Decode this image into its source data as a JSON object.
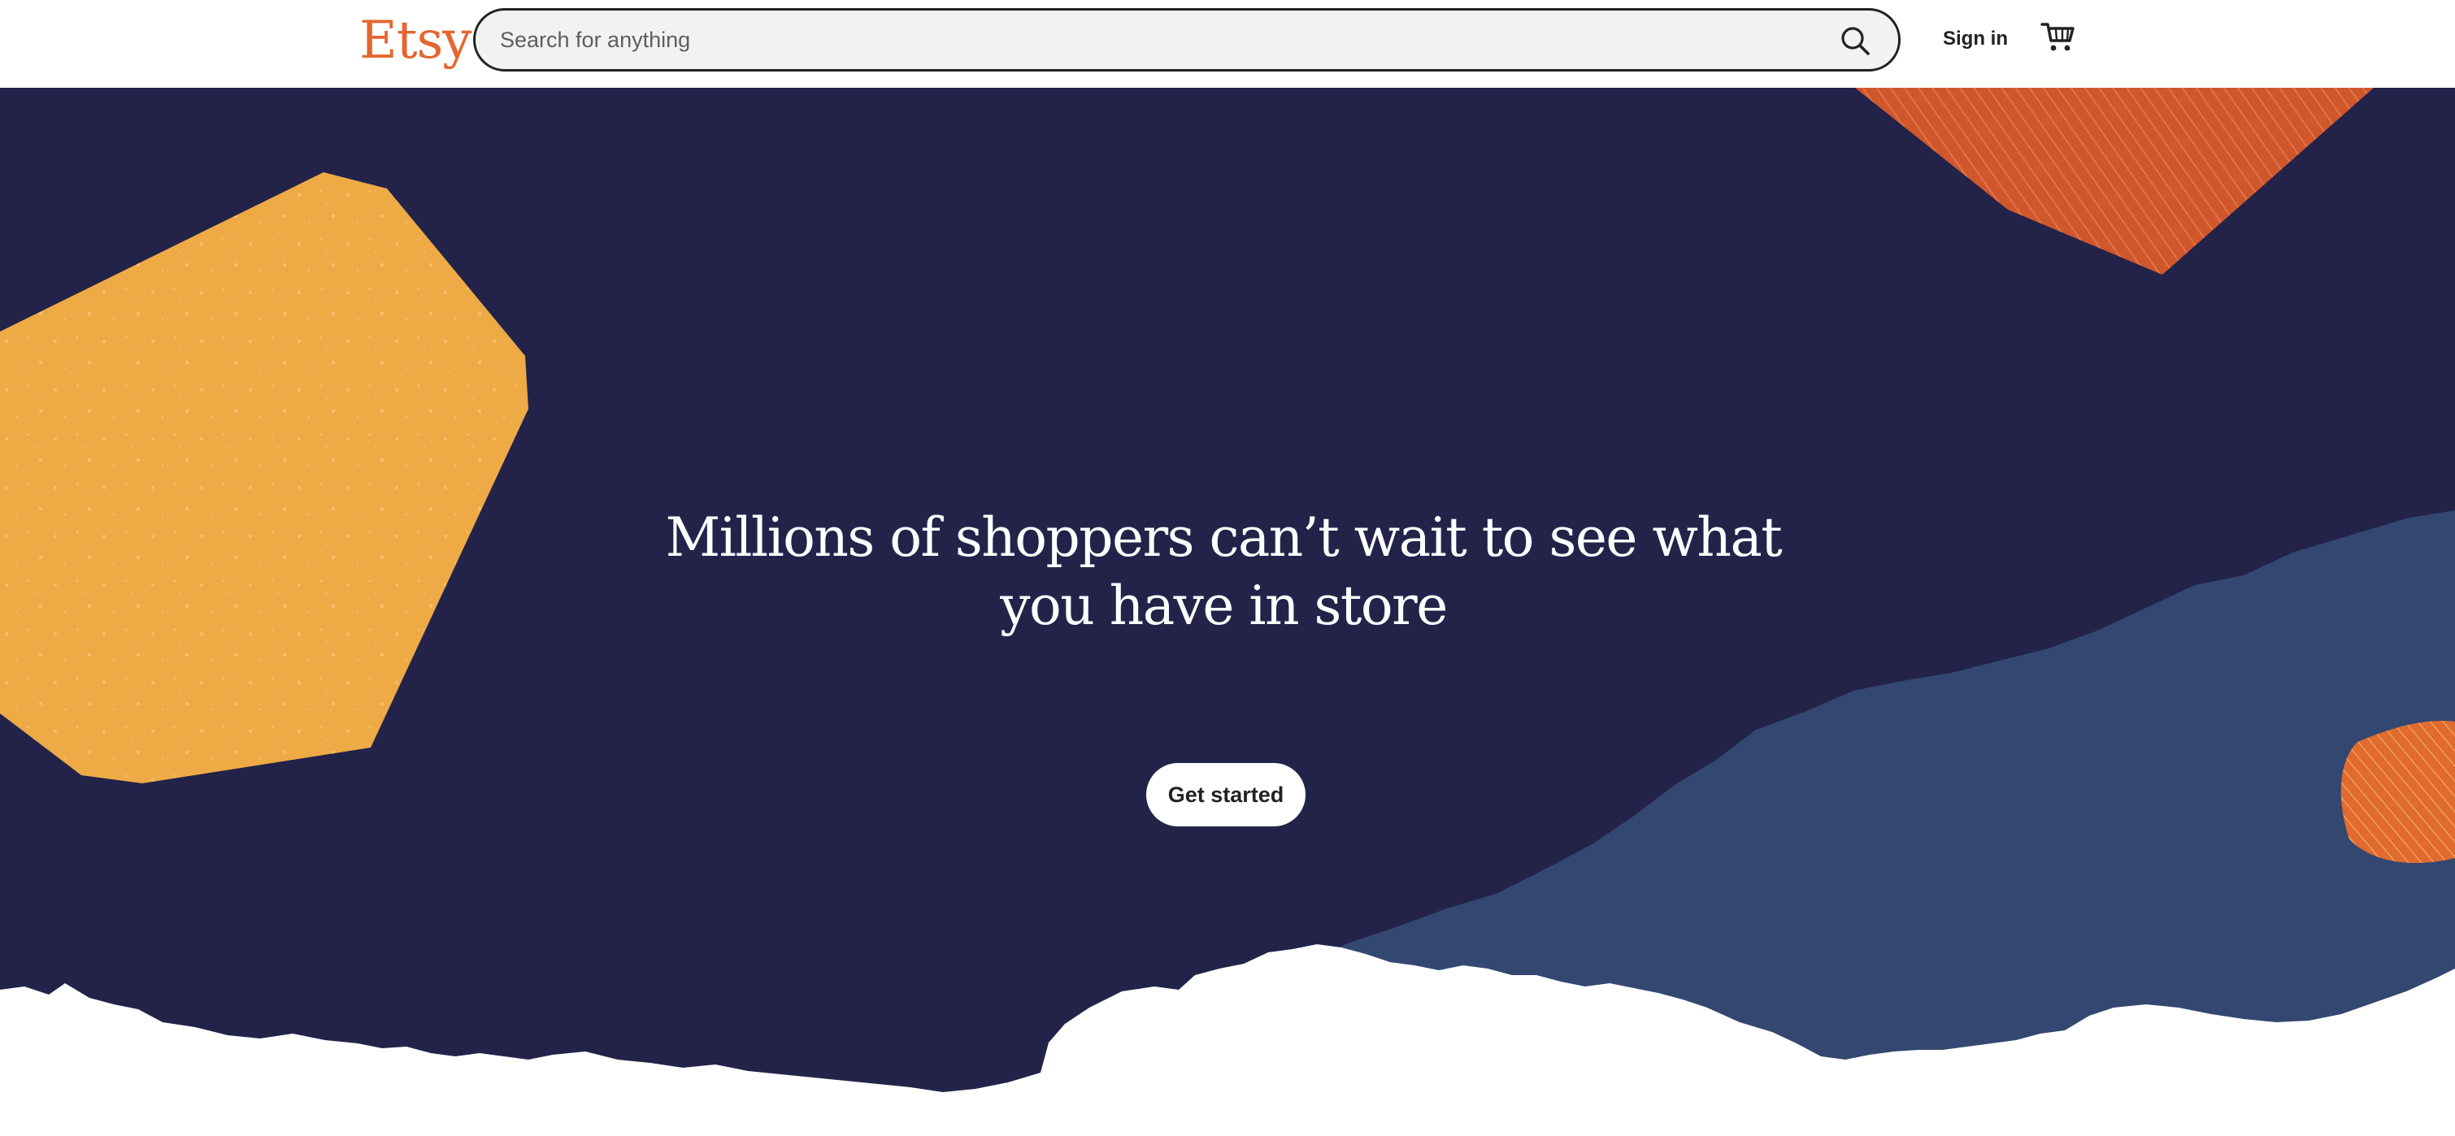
{
  "header": {
    "logo_text": "Etsy",
    "search": {
      "placeholder": "Search for anything",
      "value": ""
    },
    "signin_label": "Sign in",
    "icons": {
      "search": "search-icon",
      "cart": "cart-icon"
    }
  },
  "hero": {
    "headline_line1": "Millions of shoppers can’t wait to see what",
    "headline_line2": "you have in store",
    "cta_label": "Get started"
  },
  "colors": {
    "brand": "#e3672f",
    "hero_bg": "#23234a",
    "hero_blue": "#334770",
    "shape_yellow": "#eeaa45",
    "shape_orange": "#d35a2f"
  }
}
